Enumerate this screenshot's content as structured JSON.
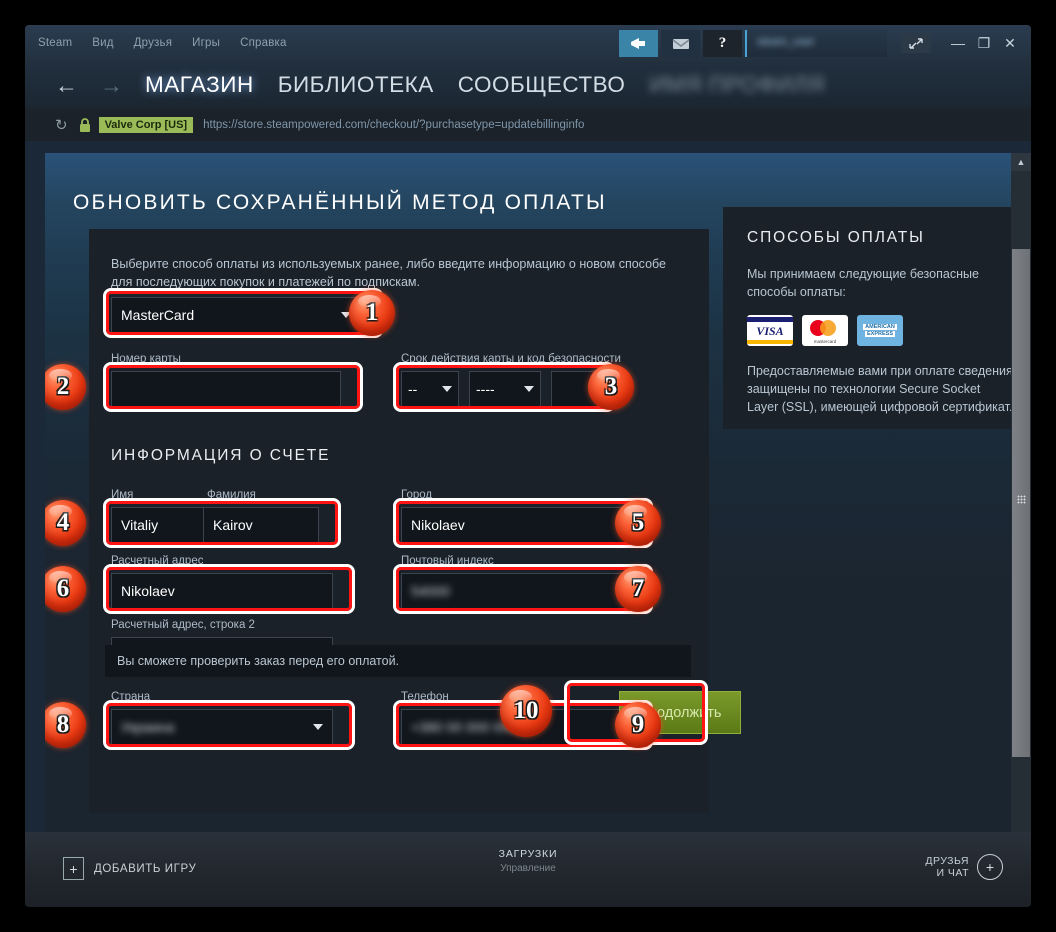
{
  "window": {
    "menu": [
      "Steam",
      "Вид",
      "Друзья",
      "Игры",
      "Справка"
    ],
    "toolbar": {
      "broadcast_icon": "megaphone-icon",
      "mail_icon": "envelope-icon",
      "help_label": "?",
      "username_blurred": "steam_user",
      "expand_icon": "expand-icon",
      "minimize_label": "—",
      "maximize_label": "❐",
      "close_label": "✕"
    },
    "nav": {
      "back_icon": "arrow-left-icon",
      "forward_icon": "arrow-right-icon",
      "tabs": [
        {
          "label": "МАГАЗИН",
          "state": "active"
        },
        {
          "label": "БИБЛИОТЕКА",
          "state": "normal"
        },
        {
          "label": "СООБЩЕСТВО",
          "state": "normal"
        },
        {
          "label": "ИМЯ ПРОФИЛЯ",
          "state": "blurred"
        }
      ]
    },
    "urlbar": {
      "reload_icon": "reload-icon",
      "lock_icon": "lock-icon",
      "certificate": "Valve Corp [US]",
      "url": "https://store.steampowered.com/checkout/?purchasetype=updatebillinginfo"
    }
  },
  "page": {
    "heading": "ОБНОВИТЬ СОХРАНЁННЫЙ МЕТОД ОПЛАТЫ",
    "intro": "Выберите способ оплаты из используемых ранее, либо введите информацию о новом способе для последующих покупок и платежей по подпискам.",
    "payment_method": {
      "value": "MasterCard"
    },
    "card_number": {
      "label": "Номер карты",
      "value": ""
    },
    "expiry": {
      "label": "Срок действия карты и код безопасности",
      "month": "--",
      "year": "----",
      "cvv": ""
    },
    "billing_heading": "ИНФОРМАЦИЯ О СЧЕТЕ",
    "fields": {
      "first_name": {
        "label": "Имя",
        "value": "Vitaliy"
      },
      "last_name": {
        "label": "Фамилия",
        "value": "Kairov"
      },
      "city": {
        "label": "Город",
        "value": "Nikolaev"
      },
      "address1": {
        "label": "Расчетный адрес",
        "value": "Nikolaev"
      },
      "postal": {
        "label": "Почтовый индекс",
        "value": "54000",
        "blurred": true
      },
      "address2": {
        "label": "Расчетный адрес, строка 2",
        "value": ""
      },
      "country": {
        "label": "Страна",
        "value": "Украина",
        "blurred": true
      },
      "phone": {
        "label": "Телефон",
        "value": "+380 00 000 0000",
        "blurred": true
      }
    },
    "note": "Вы сможете проверить заказ перед его оплатой.",
    "continue_label": "Продолжить",
    "info_panel": {
      "title": "СПОСОБЫ ОПЛАТЫ",
      "lead": "Мы принимаем следующие безопасные способы оплаты:",
      "logos": [
        "VISA",
        "mastercard",
        "AMERICAN EXPRESS"
      ],
      "footer": "Предоставляемые вами при оплате сведения защищены по технологии Secure Socket Layer (SSL), имеющей цифровой сертификат."
    },
    "callouts": [
      "1",
      "2",
      "3",
      "4",
      "5",
      "6",
      "7",
      "8",
      "9",
      "10"
    ]
  },
  "bottombar": {
    "add_game": "ДОБАВИТЬ ИГРУ",
    "downloads_title": "ЗАГРУЗКИ",
    "downloads_sub": "Управление",
    "friends_line1": "ДРУЗЬЯ",
    "friends_line2": "И ЧАТ"
  },
  "colors": {
    "accent_blue": "#3a84a8",
    "highlight_red": "#ff1414",
    "badge_orange": "#fc6237",
    "cert_green": "#9bbb59",
    "button_green": "#7a9a2b"
  }
}
